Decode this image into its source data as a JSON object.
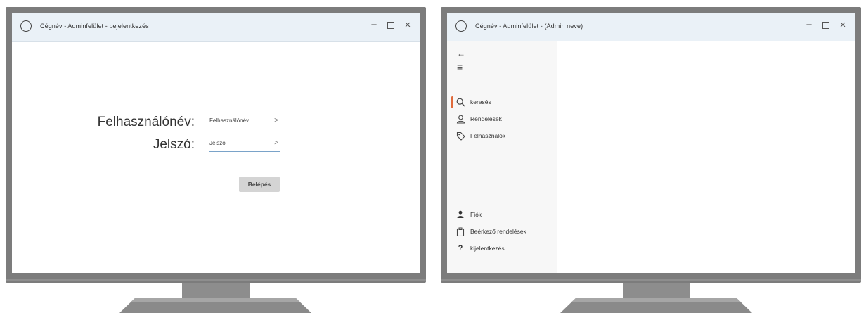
{
  "colors": {
    "monitor_frame": "#7c7c7c",
    "titlebar_bg": "#eaf1f7",
    "input_underline": "#7aa3c9",
    "button_bg": "#d4d4d4",
    "sidebar_bg": "#f7f7f7",
    "active_accent": "#e06a3b"
  },
  "login_window": {
    "title": "Cégnév - Adminfelület - bejelentkezés",
    "window_controls": {
      "minimize": "−",
      "close": "×"
    },
    "username": {
      "label": "Felhasználónév:",
      "placeholder": "Felhasználónév",
      "chevron": ">"
    },
    "password": {
      "label": "Jelszó:",
      "placeholder": "Jelszó",
      "chevron": ">"
    },
    "login_button": "Belépés"
  },
  "admin_window": {
    "title": "Cégnév - Adminfelület - (Admin neve)",
    "window_controls": {
      "minimize": "−",
      "close": "×"
    },
    "sidebar": {
      "back_icon": "←",
      "menu_icon": "≡",
      "top_items": [
        {
          "label": "keresés",
          "icon": "search-icon",
          "active": true
        },
        {
          "label": "Rendelések",
          "icon": "user-icon"
        },
        {
          "label": "Felhasználók",
          "icon": "tag-icon"
        }
      ],
      "bottom_items": [
        {
          "label": "Fiók",
          "icon": "person-filled-icon"
        },
        {
          "label": "Beérkező rendelések",
          "icon": "clipboard-icon"
        },
        {
          "label": "kijelentkezés",
          "icon": "question-icon",
          "glyph": "?"
        }
      ]
    }
  }
}
